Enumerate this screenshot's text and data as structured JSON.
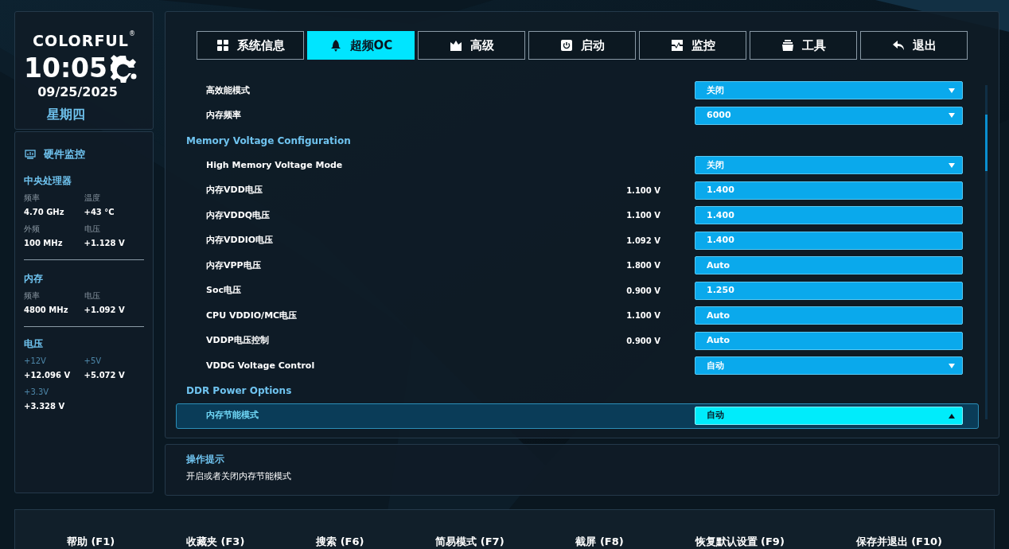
{
  "brand": {
    "logo": "COLORFUL",
    "registered": "®",
    "time": "10:05",
    "date": "09/25/2025",
    "weekday": "星期四"
  },
  "monitor": {
    "title": "硬件监控",
    "sections": [
      {
        "title": "中央处理器",
        "stats": [
          {
            "label": "频率",
            "value": "4.70 GHz"
          },
          {
            "label": "温度",
            "value": "+43 °C"
          },
          {
            "label": "外频",
            "value": "100 MHz"
          },
          {
            "label": "电压",
            "value": "+1.128 V"
          }
        ]
      },
      {
        "title": "内存",
        "stats": [
          {
            "label": "频率",
            "value": "4800 MHz"
          },
          {
            "label": "电压",
            "value": "+1.092 V"
          }
        ]
      },
      {
        "title": "电压",
        "stats": [
          {
            "label": "+12V",
            "value": "+12.096 V"
          },
          {
            "label": "+5V",
            "value": "+5.072 V"
          },
          {
            "label": "+3.3V",
            "value": "+3.328 V"
          }
        ]
      }
    ]
  },
  "tabs": [
    {
      "label": "系统信息",
      "selected": false
    },
    {
      "label": "超频OC",
      "selected": true
    },
    {
      "label": "高级",
      "selected": false
    },
    {
      "label": "启动",
      "selected": false
    },
    {
      "label": "监控",
      "selected": false
    },
    {
      "label": "工具",
      "selected": false
    },
    {
      "label": "退出",
      "selected": false
    }
  ],
  "settings": [
    {
      "kind": "dropdown",
      "label": "高效能模式",
      "value": "关闭",
      "selected": false
    },
    {
      "kind": "dropdown",
      "label": "内存频率",
      "value": "6000",
      "selected": false
    },
    {
      "kind": "heading",
      "label": "Memory Voltage Configuration"
    },
    {
      "kind": "dropdown",
      "label": "High Memory Voltage Mode",
      "value": "关闭",
      "selected": false
    },
    {
      "kind": "input",
      "label": "内存VDD电压",
      "reading": "1.100 V",
      "value": "1.400",
      "selected": false
    },
    {
      "kind": "input",
      "label": "内存VDDQ电压",
      "reading": "1.100 V",
      "value": "1.400",
      "selected": false
    },
    {
      "kind": "input",
      "label": "内存VDDIO电压",
      "reading": "1.092 V",
      "value": "1.400",
      "selected": false
    },
    {
      "kind": "input",
      "label": "内存VPP电压",
      "reading": "1.800 V",
      "value": "Auto",
      "selected": false
    },
    {
      "kind": "input",
      "label": "Soc电压",
      "reading": "0.900 V",
      "value": "1.250",
      "selected": false
    },
    {
      "kind": "input",
      "label": "CPU VDDIO/MC电压",
      "reading": "1.100 V",
      "value": "Auto",
      "selected": false
    },
    {
      "kind": "input",
      "label": "VDDP电压控制",
      "reading": "0.900 V",
      "value": "Auto",
      "selected": false
    },
    {
      "kind": "dropdown",
      "label": "VDDG Voltage Control",
      "value": "自动",
      "selected": false
    },
    {
      "kind": "heading",
      "label": "DDR Power Options"
    },
    {
      "kind": "dropdown",
      "label": "内存节能模式",
      "value": "自动",
      "selected": true
    }
  ],
  "help": {
    "title": "操作提示",
    "text": "开启或者关闭内存节能模式"
  },
  "hotkeys": [
    "帮助 (F1)",
    "收藏夹 (F3)",
    "搜索 (F6)",
    "简易模式 (F7)",
    "截屏 (F8)",
    "恢复默认设置 (F9)",
    "保存并退出 (F10)"
  ]
}
